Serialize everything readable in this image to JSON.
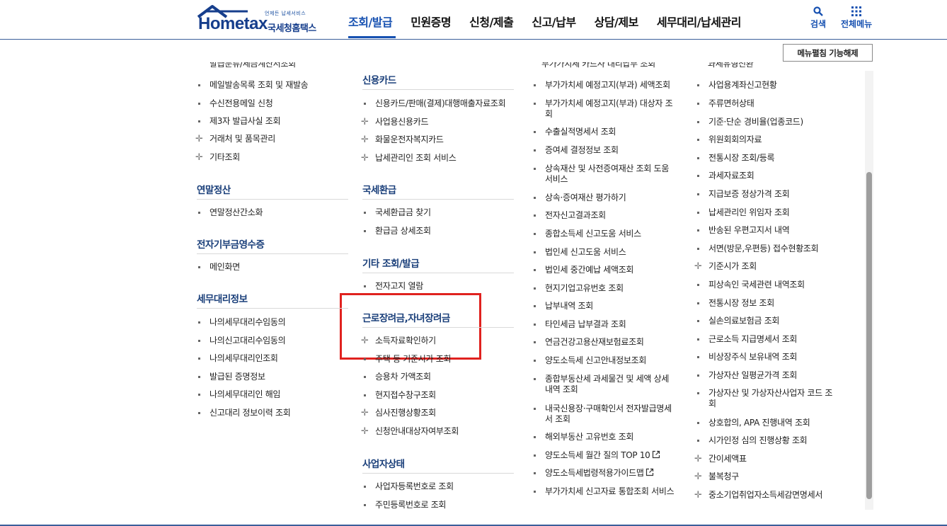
{
  "logo": {
    "tagline": "언제든 납세서비스",
    "brand": "Hometax",
    "name": "국세청홈택스"
  },
  "gnb": [
    {
      "label": "조회/발급",
      "active": true
    },
    {
      "label": "민원증명",
      "active": false
    },
    {
      "label": "신청/제출",
      "active": false
    },
    {
      "label": "신고/납부",
      "active": false
    },
    {
      "label": "상담/제보",
      "active": false
    },
    {
      "label": "세무대리/납세관리",
      "active": false
    }
  ],
  "utility": {
    "search": "검색",
    "all_menu": "전체메뉴"
  },
  "release_button": "메뉴펼침 기능해제",
  "col1": {
    "partial_top": "발급문류/세금계산서조회",
    "top_items": [
      {
        "label": "메일발송목록 조회 및 재발송",
        "type": "bullet"
      },
      {
        "label": "수신전용메일 신청",
        "type": "bullet"
      },
      {
        "label": "제3자 발급사실 조회",
        "type": "bullet"
      },
      {
        "label": "거래처 및 품목관리",
        "type": "plus"
      },
      {
        "label": "기타조회",
        "type": "plus"
      }
    ],
    "sections": [
      {
        "title": "연말정산",
        "items": [
          "연말정산간소화"
        ]
      },
      {
        "title": "전자기부금영수증",
        "items": [
          "메인화면"
        ]
      },
      {
        "title": "세무대리정보",
        "items": [
          "나의세무대리수임동의",
          "나의신고대리수임동의",
          "나의세무대리인조회",
          "발급된 증명정보",
          "나의세무대리인 해임",
          "신고대리 정보이력 조회"
        ]
      }
    ]
  },
  "col2": {
    "sections": [
      {
        "title": "신용카드",
        "items": [
          {
            "label": "신용카드/판매(결제)대행매출자료조회",
            "type": "bullet"
          },
          {
            "label": "사업용신용카드",
            "type": "plus"
          },
          {
            "label": "화물운전자복지카드",
            "type": "plus"
          },
          {
            "label": "납세관리인 조회 서비스",
            "type": "plus"
          }
        ]
      },
      {
        "title": "국세환급",
        "items": [
          {
            "label": "국세환급금 찾기",
            "type": "bullet"
          },
          {
            "label": "환급금 상세조회",
            "type": "bullet"
          }
        ]
      },
      {
        "title": "기타 조회/발급",
        "items": [
          {
            "label": "전자고지 열람",
            "type": "bullet"
          }
        ]
      },
      {
        "title": "근로장려금,자녀장려금",
        "items": [
          {
            "label": "소득자료확인하기",
            "type": "plus"
          },
          {
            "label": "주택 등 기준시가 조회",
            "type": "bullet"
          },
          {
            "label": "승용차 가액조회",
            "type": "bullet"
          },
          {
            "label": "현지접수창구조회",
            "type": "bullet"
          },
          {
            "label": "심사진행상황조회",
            "type": "plus"
          },
          {
            "label": "신청안내대상자여부조회",
            "type": "plus"
          }
        ]
      },
      {
        "title": "사업자상태",
        "items": [
          {
            "label": "사업자등록번호로 조회",
            "type": "bullet"
          },
          {
            "label": "주민등록번호로 조회",
            "type": "bullet"
          }
        ]
      }
    ]
  },
  "col3": {
    "partial_top": "부가가치세 카드사 대리납부 조회",
    "items": [
      {
        "label": "부가가치세 예정고지(부과) 세액조회",
        "type": "bullet"
      },
      {
        "label": "부가가치세 예정고지(부과) 대상자 조\n회",
        "type": "bullet"
      },
      {
        "label": "수출실적명세서 조회",
        "type": "bullet"
      },
      {
        "label": "증여세 결정정보 조회",
        "type": "bullet"
      },
      {
        "label": "상속재산 및 사전증여재산 조회 도움\n서비스",
        "type": "bullet"
      },
      {
        "label": "상속·증여재산 평가하기",
        "type": "bullet"
      },
      {
        "label": "전자신고결과조회",
        "type": "bullet"
      },
      {
        "label": "종합소득세 신고도움 서비스",
        "type": "bullet"
      },
      {
        "label": "법인세 신고도움 서비스",
        "type": "bullet"
      },
      {
        "label": "법인세 중간예납 세액조회",
        "type": "bullet"
      },
      {
        "label": "현지기업고유번호 조회",
        "type": "bullet"
      },
      {
        "label": "납부내역 조회",
        "type": "bullet"
      },
      {
        "label": "타인세금 납부결과 조회",
        "type": "bullet"
      },
      {
        "label": "연금건강고용산재보험료조회",
        "type": "bullet"
      },
      {
        "label": "양도소득세 신고안내정보조회",
        "type": "bullet"
      },
      {
        "label": "종합부동산세 과세물건 및 세액 상세\n내역 조회",
        "type": "bullet"
      },
      {
        "label": "내국신용장·구매확인서 전자발급명세\n서 조회",
        "type": "bullet"
      },
      {
        "label": "해외부동산 고유번호 조회",
        "type": "bullet"
      },
      {
        "label": "양도소득세 월간 질의 TOP 10",
        "type": "bullet",
        "external": true
      },
      {
        "label": "양도소득세법령적용가이드맵",
        "type": "bullet",
        "external": true
      },
      {
        "label": "부가가치세 신고자료 통합조회 서비스",
        "type": "bullet"
      }
    ]
  },
  "col4": {
    "partial_top": "과세유형전환",
    "items": [
      {
        "label": "사업용계좌신고현황",
        "type": "bullet"
      },
      {
        "label": "주류면허상태",
        "type": "bullet"
      },
      {
        "label": "기준·단순 경비율(업종코드)",
        "type": "bullet"
      },
      {
        "label": "위원회회의자료",
        "type": "bullet"
      },
      {
        "label": "전통시장 조회/등록",
        "type": "bullet"
      },
      {
        "label": "과세자료조회",
        "type": "bullet"
      },
      {
        "label": "지급보증 정상가격 조회",
        "type": "bullet"
      },
      {
        "label": "납세관리인 위임자 조회",
        "type": "bullet"
      },
      {
        "label": "반송된 우편고지서 내역",
        "type": "bullet"
      },
      {
        "label": "서면(방문,우편등) 접수현황조회",
        "type": "bullet"
      },
      {
        "label": "기준시가 조회",
        "type": "plus"
      },
      {
        "label": "피상속인 국세관련 내역조회",
        "type": "bullet"
      },
      {
        "label": "전통시장 정보 조회",
        "type": "bullet"
      },
      {
        "label": "실손의료보험금 조회",
        "type": "bullet"
      },
      {
        "label": "근로소득 지급명세서 조회",
        "type": "bullet"
      },
      {
        "label": "비상장주식 보유내역 조회",
        "type": "bullet"
      },
      {
        "label": "가상자산 일평균가격 조회",
        "type": "bullet"
      },
      {
        "label": "가상자산 및 가상자산사업자 코드 조\n회",
        "type": "bullet"
      },
      {
        "label": "상호합의, APA 진행내역 조회",
        "type": "bullet"
      },
      {
        "label": "시가인정 심의 진행상황 조회",
        "type": "bullet"
      },
      {
        "label": "간이세액표",
        "type": "plus"
      },
      {
        "label": "불복청구",
        "type": "plus"
      },
      {
        "label": "중소기업취업자소득세감면명세서",
        "type": "plus"
      }
    ]
  }
}
